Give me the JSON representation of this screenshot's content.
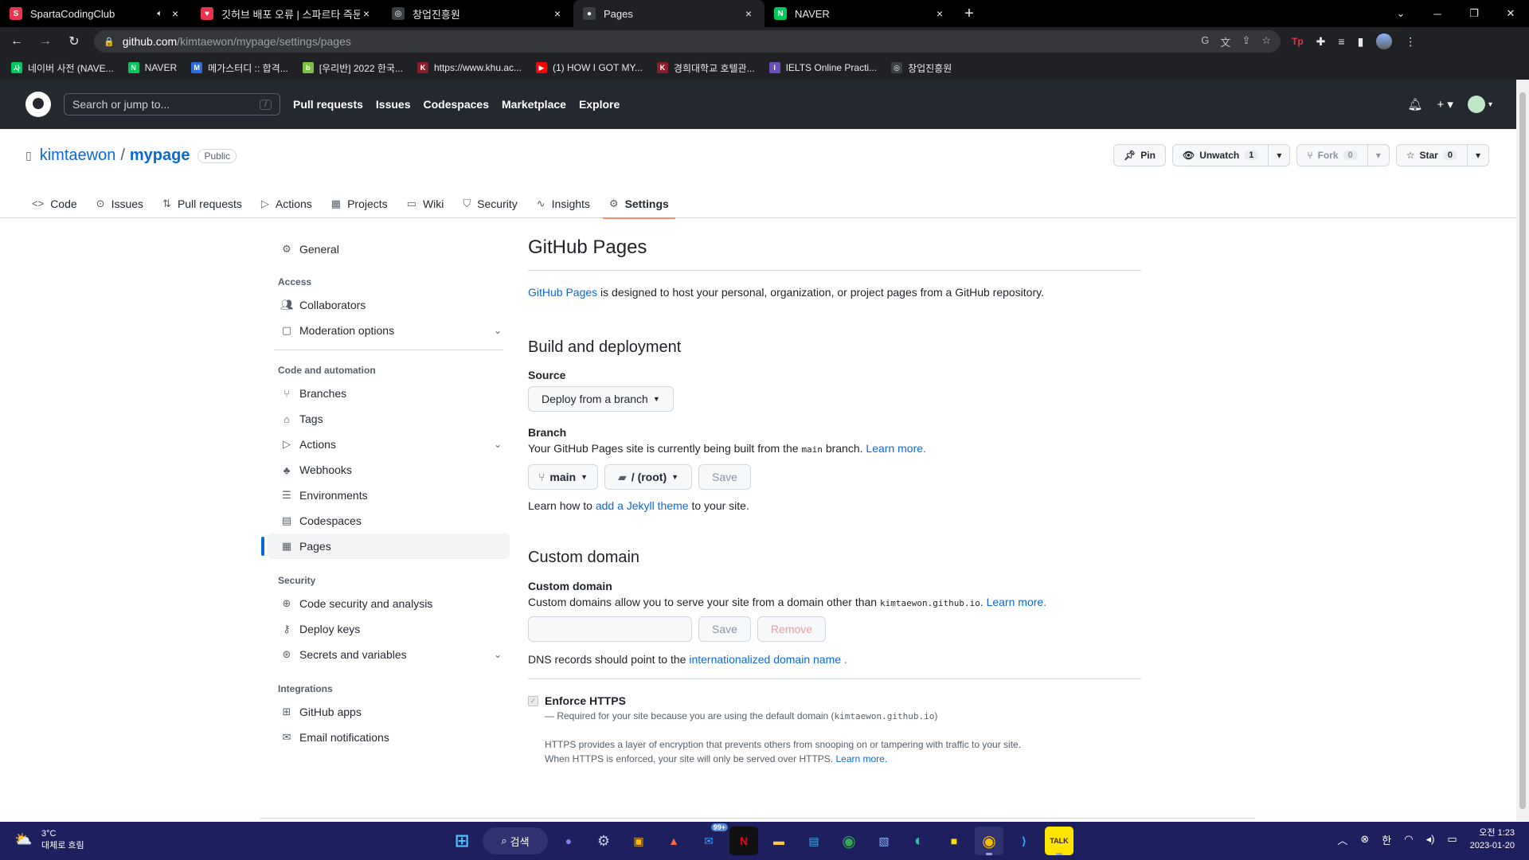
{
  "browser": {
    "tabs": [
      {
        "title": "SpartaCodingClub",
        "color": "#e8344e",
        "glyph": "S",
        "audio": true
      },
      {
        "title": "깃허브 배포 오류 | 스파르타 즉문",
        "color": "#e8344e",
        "glyph": "♥",
        "audio": false
      },
      {
        "title": "창업진흥원",
        "color": "#3c4043",
        "glyph": "◎",
        "audio": false
      },
      {
        "title": "Pages",
        "color": "#3c4043",
        "glyph": "●",
        "audio": false
      },
      {
        "title": "NAVER",
        "color": "#03c75a",
        "glyph": "N",
        "audio": false
      }
    ],
    "active_tab": 3,
    "url_host": "github.com",
    "url_path": "/kimtaewon/mypage/settings/pages",
    "bookmarks": [
      {
        "label": "네이버 사전 (NAVE...",
        "color": "#03c75a",
        "glyph": "사"
      },
      {
        "label": "NAVER",
        "color": "#03c75a",
        "glyph": "N"
      },
      {
        "label": "메가스터디 :: 합격...",
        "color": "#2a6fdb",
        "glyph": "M"
      },
      {
        "label": "[우리반] 2022 한국...",
        "color": "#7cc242",
        "glyph": "b"
      },
      {
        "label": "https://www.khu.ac...",
        "color": "#8b1e2d",
        "glyph": "K"
      },
      {
        "label": "(1) HOW I GOT MY...",
        "color": "#ff0000",
        "glyph": "▶"
      },
      {
        "label": "경희대학교 호텔관...",
        "color": "#8b1e2d",
        "glyph": "K"
      },
      {
        "label": "IELTS Online Practi...",
        "color": "#6b4fbb",
        "glyph": "I"
      },
      {
        "label": "창업진흥원",
        "color": "#3c4043",
        "glyph": "◎"
      }
    ]
  },
  "gh": {
    "search_placeholder": "Search or jump to...",
    "search_key": "/",
    "nav": [
      "Pull requests",
      "Issues",
      "Codespaces",
      "Marketplace",
      "Explore"
    ]
  },
  "repo": {
    "owner": "kimtaewon",
    "name": "mypage",
    "visibility": "Public",
    "pin": "Pin",
    "unwatch": "Unwatch",
    "unwatch_count": "1",
    "fork": "Fork",
    "fork_count": "0",
    "star": "Star",
    "star_count": "0",
    "tabs": [
      {
        "label": "Code",
        "icon": "<>"
      },
      {
        "label": "Issues",
        "icon": "⊙"
      },
      {
        "label": "Pull requests",
        "icon": "⇅"
      },
      {
        "label": "Actions",
        "icon": "▷"
      },
      {
        "label": "Projects",
        "icon": "▦"
      },
      {
        "label": "Wiki",
        "icon": "▭"
      },
      {
        "label": "Security",
        "icon": "⛉"
      },
      {
        "label": "Insights",
        "icon": "∿"
      },
      {
        "label": "Settings",
        "icon": "⚙"
      }
    ],
    "active_tab": 8
  },
  "sidebar": {
    "general": "General",
    "access_heading": "Access",
    "collaborators": "Collaborators",
    "moderation": "Moderation options",
    "code_heading": "Code and automation",
    "branches": "Branches",
    "tags": "Tags",
    "actions": "Actions",
    "webhooks": "Webhooks",
    "environments": "Environments",
    "codespaces": "Codespaces",
    "pages": "Pages",
    "security_heading": "Security",
    "code_security": "Code security and analysis",
    "deploy_keys": "Deploy keys",
    "secrets": "Secrets and variables",
    "integrations_heading": "Integrations",
    "github_apps": "GitHub apps",
    "email_notifications": "Email notifications"
  },
  "pages": {
    "title": "GitHub Pages",
    "intro_link": "GitHub Pages",
    "intro_rest": " is designed to host your personal, organization, or project pages from a GitHub repository.",
    "build_heading": "Build and deployment",
    "source_label": "Source",
    "source_value": "Deploy from a branch",
    "branch_label": "Branch",
    "branch_note_pre": "Your GitHub Pages site is currently being built from the ",
    "branch_code": "main",
    "branch_note_post": " branch. ",
    "learn_more": "Learn more.",
    "branch_value": "main",
    "folder_value": "/ (root)",
    "save": "Save",
    "jekyll_pre": "Learn how to ",
    "jekyll_link": "add a Jekyll theme",
    "jekyll_post": " to your site.",
    "custom_heading": "Custom domain",
    "custom_label": "Custom domain",
    "custom_note_pre": "Custom domains allow you to serve your site from a domain other than ",
    "custom_code": "kimtaewon.github.io",
    "custom_note_post": ". ",
    "remove": "Remove",
    "dns_pre": "DNS records should point to the ",
    "dns_link": "internationalized domain name",
    "dns_post": " .",
    "https_label": "Enforce HTTPS",
    "https_required": "— Required for your site because you are using the default domain (",
    "https_domain": "kimtaewon.github.io",
    "https_required_end": ")",
    "https_desc1": "HTTPS provides a layer of encryption that prevents others from snooping on or tampering with traffic to your site.",
    "https_desc2": "When HTTPS is enforced, your site will only be served over HTTPS. ",
    "https_learn": "Learn more."
  },
  "taskbar": {
    "temp": "3°C",
    "weather": "대체로 흐림",
    "search": "검색",
    "mail_badge": "99+",
    "ime": "한",
    "time": "오전 1:23",
    "date": "2023-01-20"
  }
}
